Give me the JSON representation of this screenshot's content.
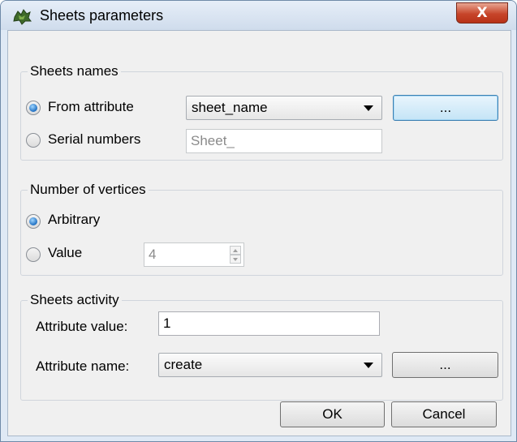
{
  "window": {
    "title": "Sheets parameters",
    "close_label": "X"
  },
  "sheets_names": {
    "group_title": "Sheets names",
    "from_attribute": {
      "label": "From attribute",
      "checked": true,
      "combo_value": "sheet_name",
      "browse_label": "..."
    },
    "serial_numbers": {
      "label": "Serial numbers",
      "checked": false,
      "prefix_value": "Sheet_"
    }
  },
  "vertices": {
    "group_title": "Number of vertices",
    "arbitrary": {
      "label": "Arbitrary",
      "checked": true
    },
    "value": {
      "label": "Value",
      "checked": false,
      "spin_value": "4"
    }
  },
  "activity": {
    "group_title": "Sheets activity",
    "attribute_value_label": "Attribute value:",
    "attribute_value": "1",
    "attribute_name_label": "Attribute name:",
    "attribute_name_value": "create",
    "browse_label": "..."
  },
  "buttons": {
    "ok": "OK",
    "cancel": "Cancel"
  }
}
